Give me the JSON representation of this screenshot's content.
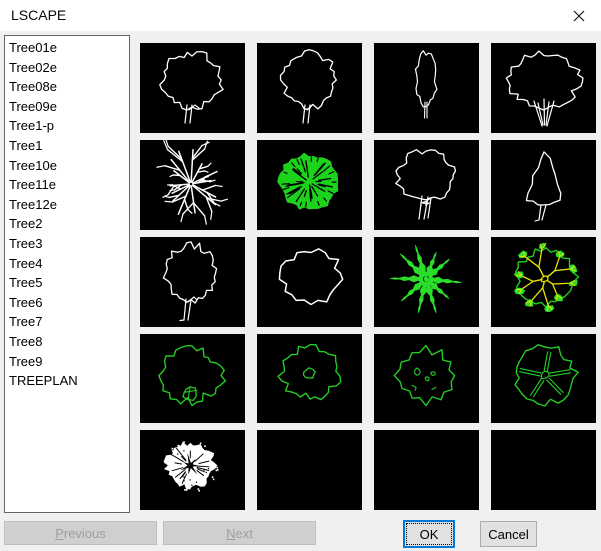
{
  "window": {
    "title": "LSCAPE",
    "close_icon": "✕"
  },
  "slide_list": {
    "items": [
      "Tree01e",
      "Tree02e",
      "Tree08e",
      "Tree09e",
      "Tree1-p",
      "Tree1",
      "Tree10e",
      "Tree11e",
      "Tree12e",
      "Tree2",
      "Tree3",
      "Tree4",
      "Tree5",
      "Tree6",
      "Tree7",
      "Tree8",
      "Tree9",
      "TREEPLAN"
    ]
  },
  "preview_grid": {
    "tiles": [
      {
        "name": "tile-tree-elevation-outline",
        "kind": "canopy"
      },
      {
        "name": "tile-tree-elevation-outline-narrow",
        "kind": "canopy2"
      },
      {
        "name": "tile-tree-poplar-outline",
        "kind": "poplar"
      },
      {
        "name": "tile-tree-oak-outline",
        "kind": "oak"
      },
      {
        "name": "tile-tree-plan-branches-white",
        "kind": "branches"
      },
      {
        "name": "tile-tree-plan-filled-green",
        "kind": "greendisc"
      },
      {
        "name": "tile-tree-bushy-outline",
        "kind": "roundtree"
      },
      {
        "name": "tile-tree-conifer-outline",
        "kind": "conifer"
      },
      {
        "name": "tile-tree-oval-outline",
        "kind": "ovaltree"
      },
      {
        "name": "tile-tree-blob-outline",
        "kind": "blobcircle"
      },
      {
        "name": "tile-tree-plan-palm-green",
        "kind": "palm"
      },
      {
        "name": "tile-tree-plan-yellow-branches",
        "kind": "yellowtree"
      },
      {
        "name": "tile-tree-plan-circle-rock",
        "kind": "planrock"
      },
      {
        "name": "tile-tree-plan-circle-center",
        "kind": "plancenter"
      },
      {
        "name": "tile-tree-plan-circle-blobs",
        "kind": "planblobs"
      },
      {
        "name": "tile-tree-plan-circle-spokes",
        "kind": "planspokes"
      },
      {
        "name": "tile-tree-plan-fluffy-white",
        "kind": "fluffy"
      },
      {
        "name": "tile-empty",
        "kind": "empty"
      },
      {
        "name": "tile-empty",
        "kind": "empty"
      },
      {
        "name": "tile-empty",
        "kind": "empty"
      }
    ]
  },
  "action_bar": {
    "previous": {
      "label": "Previous",
      "access_key": "P",
      "label_rest": "revious",
      "enabled": false
    },
    "next": {
      "label": "Next",
      "access_key": "N",
      "label_rest": "ext",
      "enabled": false
    },
    "ok": {
      "label": "OK",
      "focused": true
    },
    "cancel": {
      "label": "Cancel"
    }
  },
  "colors": {
    "dialog_bg": "#f0f0f0",
    "titlebar_bg": "#ffffff",
    "tile_bg": "#000000",
    "white": "#ffffff",
    "green_stroke": "#25cc25",
    "green_fill": "#1bd31b",
    "green_fill2": "#2ade2a",
    "yellow": "#e5e500",
    "focus_blue": "#0078d7"
  }
}
